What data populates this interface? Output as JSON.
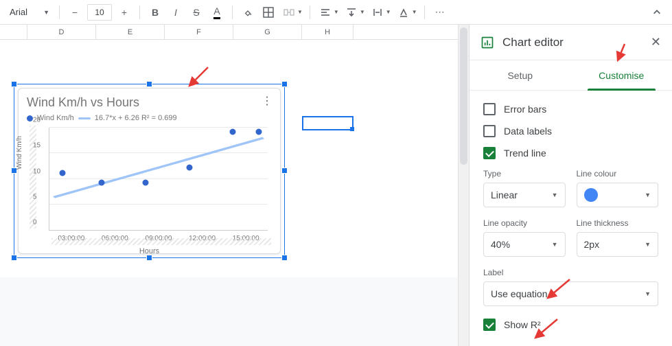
{
  "toolbar": {
    "font": "Arial",
    "size": "10"
  },
  "columns": [
    "D",
    "E",
    "F",
    "G",
    "H"
  ],
  "chart_data": {
    "type": "scatter",
    "title": "Wind Km/h vs Hours",
    "xlabel": "Hours",
    "ylabel": "Wind Km/h",
    "series_name": "Wind Km/h",
    "trend_label": "16.7*x + 6.26 R² = 0.699",
    "x_categories": [
      "03:00:00",
      "06:00:00",
      "09:00:00",
      "12:00:00",
      "15:00:00"
    ],
    "y_ticks": [
      0,
      5,
      10,
      15,
      20
    ],
    "ylim": [
      0,
      20
    ],
    "points": [
      {
        "x": "03:00:00",
        "y": 10
      },
      {
        "x": "06:00:00",
        "y": 8
      },
      {
        "x": "09:00:00",
        "y": 8
      },
      {
        "x": "12:00:00",
        "y": 11
      },
      {
        "x": "15:00:00",
        "y": 18
      },
      {
        "x": "16:00:00",
        "y": 18
      }
    ],
    "trendline": {
      "type": "linear",
      "equation": "16.7*x + 6.26",
      "r2": 0.699
    }
  },
  "sidebar": {
    "title": "Chart editor",
    "tab_setup": "Setup",
    "tab_customise": "Customise",
    "error_bars": "Error bars",
    "data_labels": "Data labels",
    "trend_line": "Trend line",
    "type_label": "Type",
    "type_value": "Linear",
    "line_colour_label": "Line colour",
    "line_opacity_label": "Line opacity",
    "line_opacity_value": "40%",
    "line_thickness_label": "Line thickness",
    "line_thickness_value": "2px",
    "label_label": "Label",
    "label_value": "Use equation",
    "show_r2": "Show R²"
  }
}
